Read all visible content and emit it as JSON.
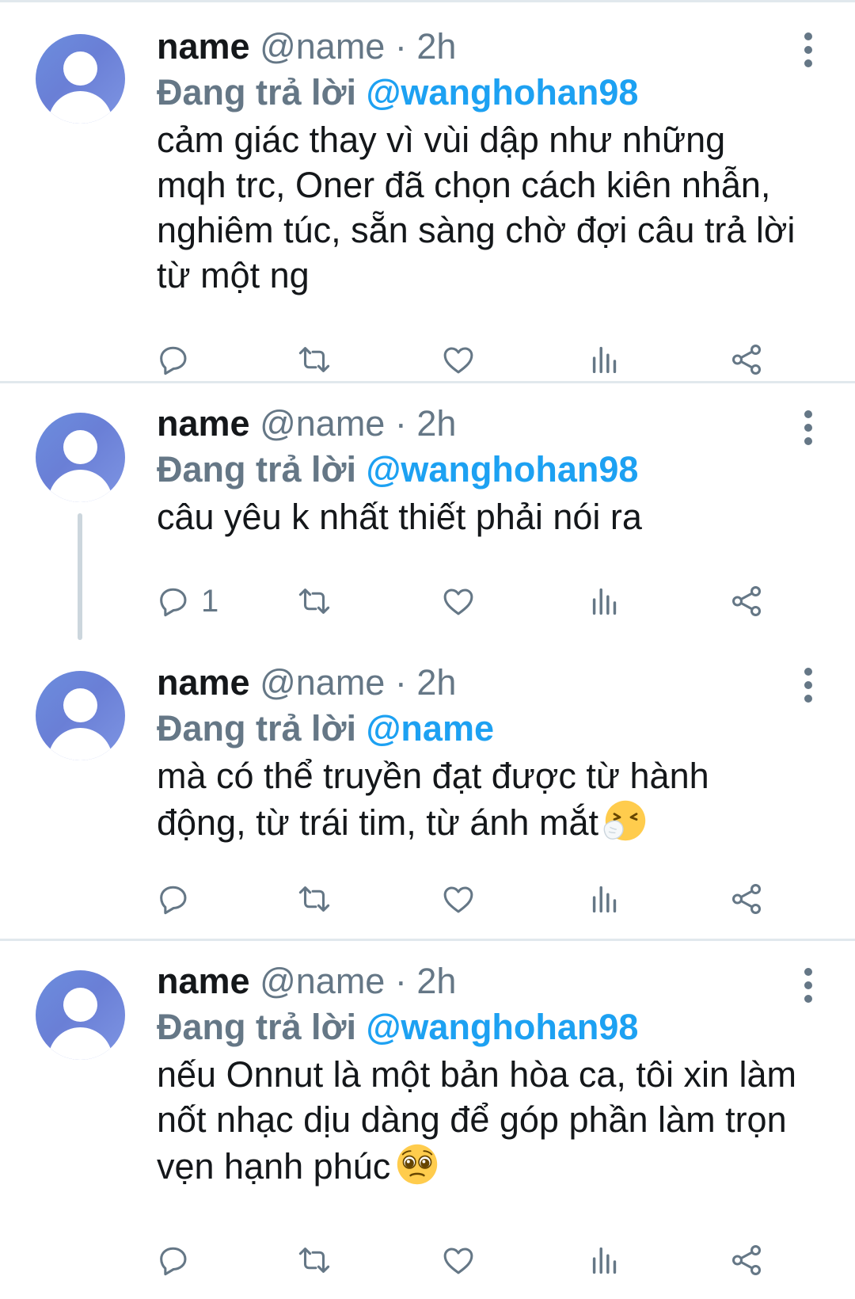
{
  "tweets": [
    {
      "display_name": "name",
      "handle": "@name",
      "separator": "·",
      "time": "2h",
      "reply_prefix": "Đang trả lời",
      "reply_target": "@wanghohan98",
      "text": "cảm giác thay vì vùi dập như những mqh trc, Oner đã chọn cách kiên nhẫn, nghiêm túc, sẵn sàng chờ đợi câu trả lời từ một ng",
      "reply_count": "",
      "emoji": ""
    },
    {
      "display_name": "name",
      "handle": "@name",
      "separator": "·",
      "time": "2h",
      "reply_prefix": "Đang trả lời",
      "reply_target": "@wanghohan98",
      "text": "câu yêu k nhất thiết phải nói ra",
      "reply_count": "1",
      "emoji": ""
    },
    {
      "display_name": "name",
      "handle": "@name",
      "separator": "·",
      "time": "2h",
      "reply_prefix": "Đang trả lời",
      "reply_target": "@name",
      "text": "mà có thể truyền đạt được từ hành động, từ trái tim, từ ánh mắt",
      "reply_count": "",
      "emoji": "sneezing-face-emoji"
    },
    {
      "display_name": "name",
      "handle": "@name",
      "separator": "·",
      "time": "2h",
      "reply_prefix": "Đang trả lời",
      "reply_target": "@wanghohan98",
      "text": "nếu Onnut là một bản hòa ca, tôi xin làm nốt nhạc dịu dàng để góp phần làm trọn vẹn hạnh phúc",
      "reply_count": "",
      "emoji": "pleading-face-emoji"
    }
  ],
  "icons": {
    "reply": "reply-icon",
    "retweet": "retweet-icon",
    "like": "like-icon",
    "analytics": "analytics-icon",
    "share": "share-icon",
    "more": "more-vertical-icon"
  },
  "colors": {
    "text_primary": "#14171a",
    "text_secondary": "#657786",
    "link": "#1da1f2",
    "divider": "#e1e8ed",
    "avatar": "#6a7fd6"
  }
}
